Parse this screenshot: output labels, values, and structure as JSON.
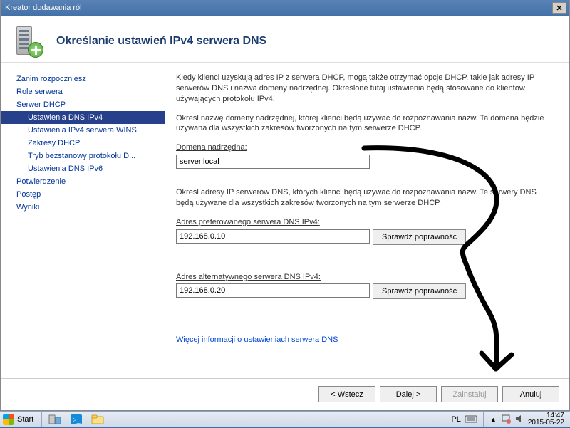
{
  "window_title": "Kreator dodawania ról",
  "heading": "Określanie ustawień IPv4 serwera DNS",
  "sidebar": {
    "items": [
      {
        "label": "Zanim rozpoczniesz",
        "indent": 0
      },
      {
        "label": "Role serwera",
        "indent": 0
      },
      {
        "label": "Serwer DHCP",
        "indent": 0
      },
      {
        "label": "Ustawienia DNS IPv4",
        "indent": 1,
        "selected": true
      },
      {
        "label": "Ustawienia IPv4 serwera WINS",
        "indent": 1
      },
      {
        "label": "Zakresy DHCP",
        "indent": 1
      },
      {
        "label": "Tryb bezstanowy protokołu D...",
        "indent": 1
      },
      {
        "label": "Ustawienia DNS IPv6",
        "indent": 1
      },
      {
        "label": "Potwierdzenie",
        "indent": 0
      },
      {
        "label": "Postęp",
        "indent": 0
      },
      {
        "label": "Wyniki",
        "indent": 0
      }
    ]
  },
  "main": {
    "intro": "Kiedy klienci uzyskują adres IP z serwera DHCP, mogą także otrzymać opcje DHCP, takie jak adresy IP serwerów DNS i nazwa domeny nadrzędnej. Określone tutaj ustawienia będą stosowane do klientów używających protokołu IPv4.",
    "domain_label": "Domena nadrzędna:",
    "domain_instr": "Określ nazwę domeny nadrzędnej, której klienci będą używać do rozpoznawania nazw. Ta domena będzie używana dla wszystkich zakresów tworzonych na tym serwerze DHCP.",
    "domain_value": "server.local",
    "dns_instr": "Określ adresy IP serwerów DNS, których klienci będą używać do rozpoznawania nazw. Te serwery DNS będą używane dla wszystkich zakresów tworzonych na tym serwerze DHCP.",
    "pref_label": "Adres preferowanego serwera DNS IPv4:",
    "pref_value": "192.168.0.10",
    "alt_label": "Adres alternatywnego serwera DNS IPv4:",
    "alt_value": "192.168.0.20",
    "validate_btn": "Sprawdź poprawność",
    "more_link": "Więcej informacji o ustawieniach serwera DNS"
  },
  "footer": {
    "back": "< Wstecz",
    "next": "Dalej >",
    "install": "Zainstaluj",
    "cancel": "Anuluj"
  },
  "taskbar": {
    "start": "Start",
    "lang": "PL",
    "time": "14:47",
    "date": "2015-05-22"
  }
}
